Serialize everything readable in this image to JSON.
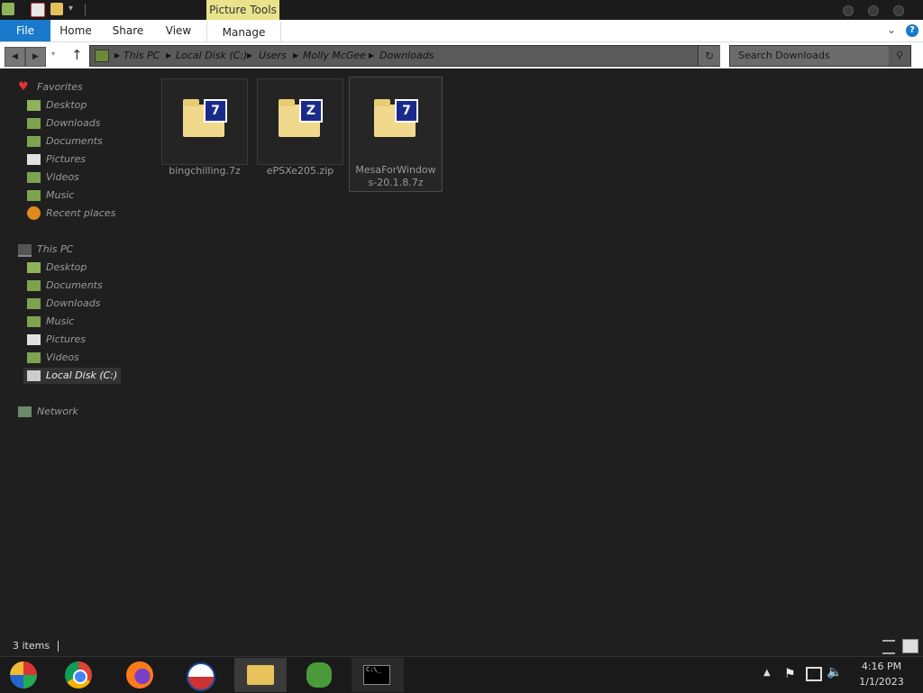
{
  "ribbon": {
    "contextual_label": "Picture Tools",
    "tabs": [
      "File",
      "Home",
      "Share",
      "View",
      "Manage"
    ]
  },
  "address": {
    "crumbs": [
      "This PC",
      "Local Disk (C:)",
      "Users",
      "Molly McGee",
      "Downloads"
    ]
  },
  "search": {
    "placeholder": "Search Downloads"
  },
  "nav": {
    "favorites_label": "Favorites",
    "favorites": [
      "Desktop",
      "Downloads",
      "Documents",
      "Pictures",
      "Videos",
      "Music",
      "Recent places"
    ],
    "thispc_label": "This PC",
    "thispc": [
      "Desktop",
      "Documents",
      "Downloads",
      "Music",
      "Pictures",
      "Videos",
      "Local Disk (C:)"
    ],
    "network_label": "Network"
  },
  "files": [
    {
      "name": "bingchilling.7z",
      "badge": "7"
    },
    {
      "name": "ePSXe205.zip",
      "badge": "Z"
    },
    {
      "name_line1": "MesaForWindow",
      "name_line2": "s-20.1.8.7z",
      "badge": "7"
    }
  ],
  "status": {
    "items_count": "3 items"
  },
  "clock": {
    "time": "4:16 PM",
    "date": "1/1/2023"
  },
  "taskbar": {
    "console_text": "C:\\_"
  },
  "colors": {
    "file_tab": "#1979ca",
    "picture_tools": "#e9e38c"
  }
}
